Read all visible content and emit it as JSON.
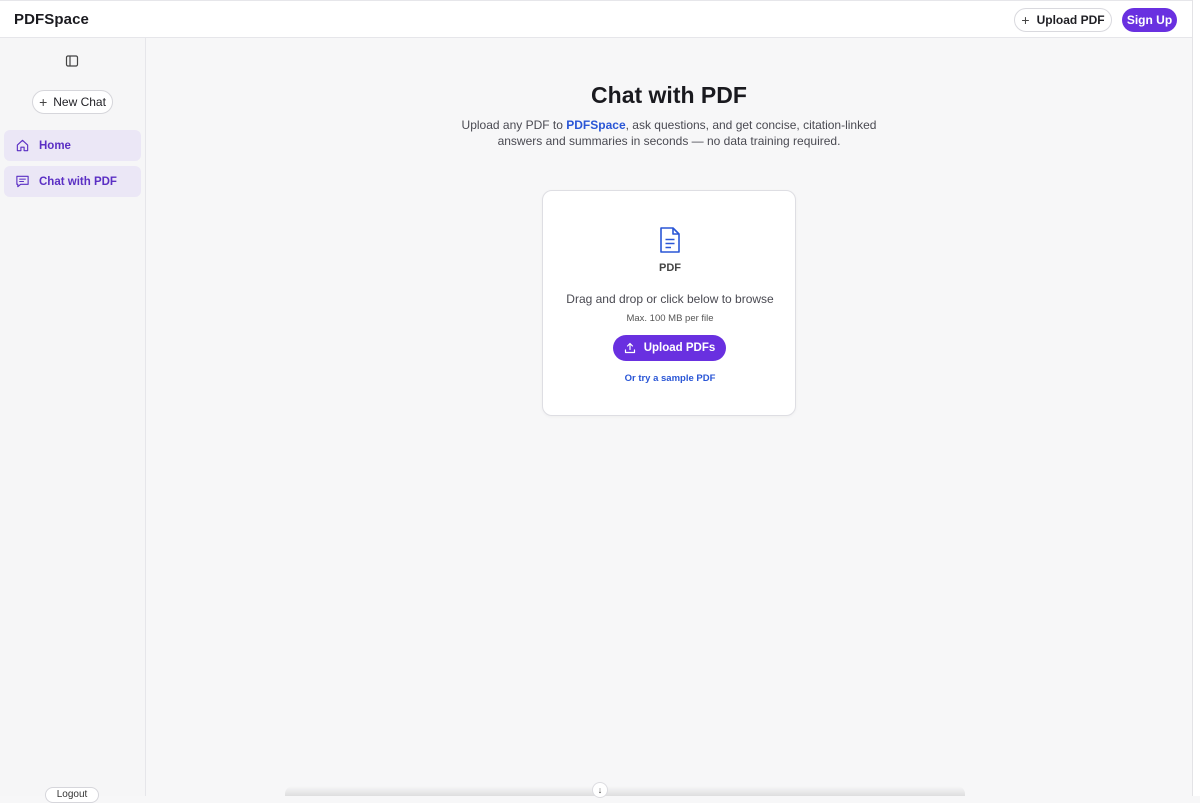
{
  "header": {
    "logo": "PDFSpace",
    "upload_button": "Upload PDF",
    "signup_button": "Sign Up"
  },
  "sidebar": {
    "new_chat_label": "New Chat",
    "items": [
      {
        "label": "Home",
        "icon": "home-icon"
      },
      {
        "label": "Chat with PDF",
        "icon": "chat-icon"
      }
    ],
    "logout_label": "Logout"
  },
  "main": {
    "title": "Chat with PDF",
    "subtitle_prefix": "Upload any PDF to ",
    "subtitle_brand": "PDFSpace",
    "subtitle_suffix": ", ask questions, and get concise, citation-linked answers and summaries in seconds — no data training required.",
    "card": {
      "file_type_label": "PDF",
      "drag_text": "Drag and drop or click below to browse",
      "max_size_text": "Max. 100 MB per file",
      "upload_button": "Upload PDFs",
      "sample_link": "Or try a sample PDF"
    }
  },
  "colors": {
    "accent": "#6930e0",
    "link": "#2a56d6",
    "nav_active_bg": "#ebe7f6"
  }
}
